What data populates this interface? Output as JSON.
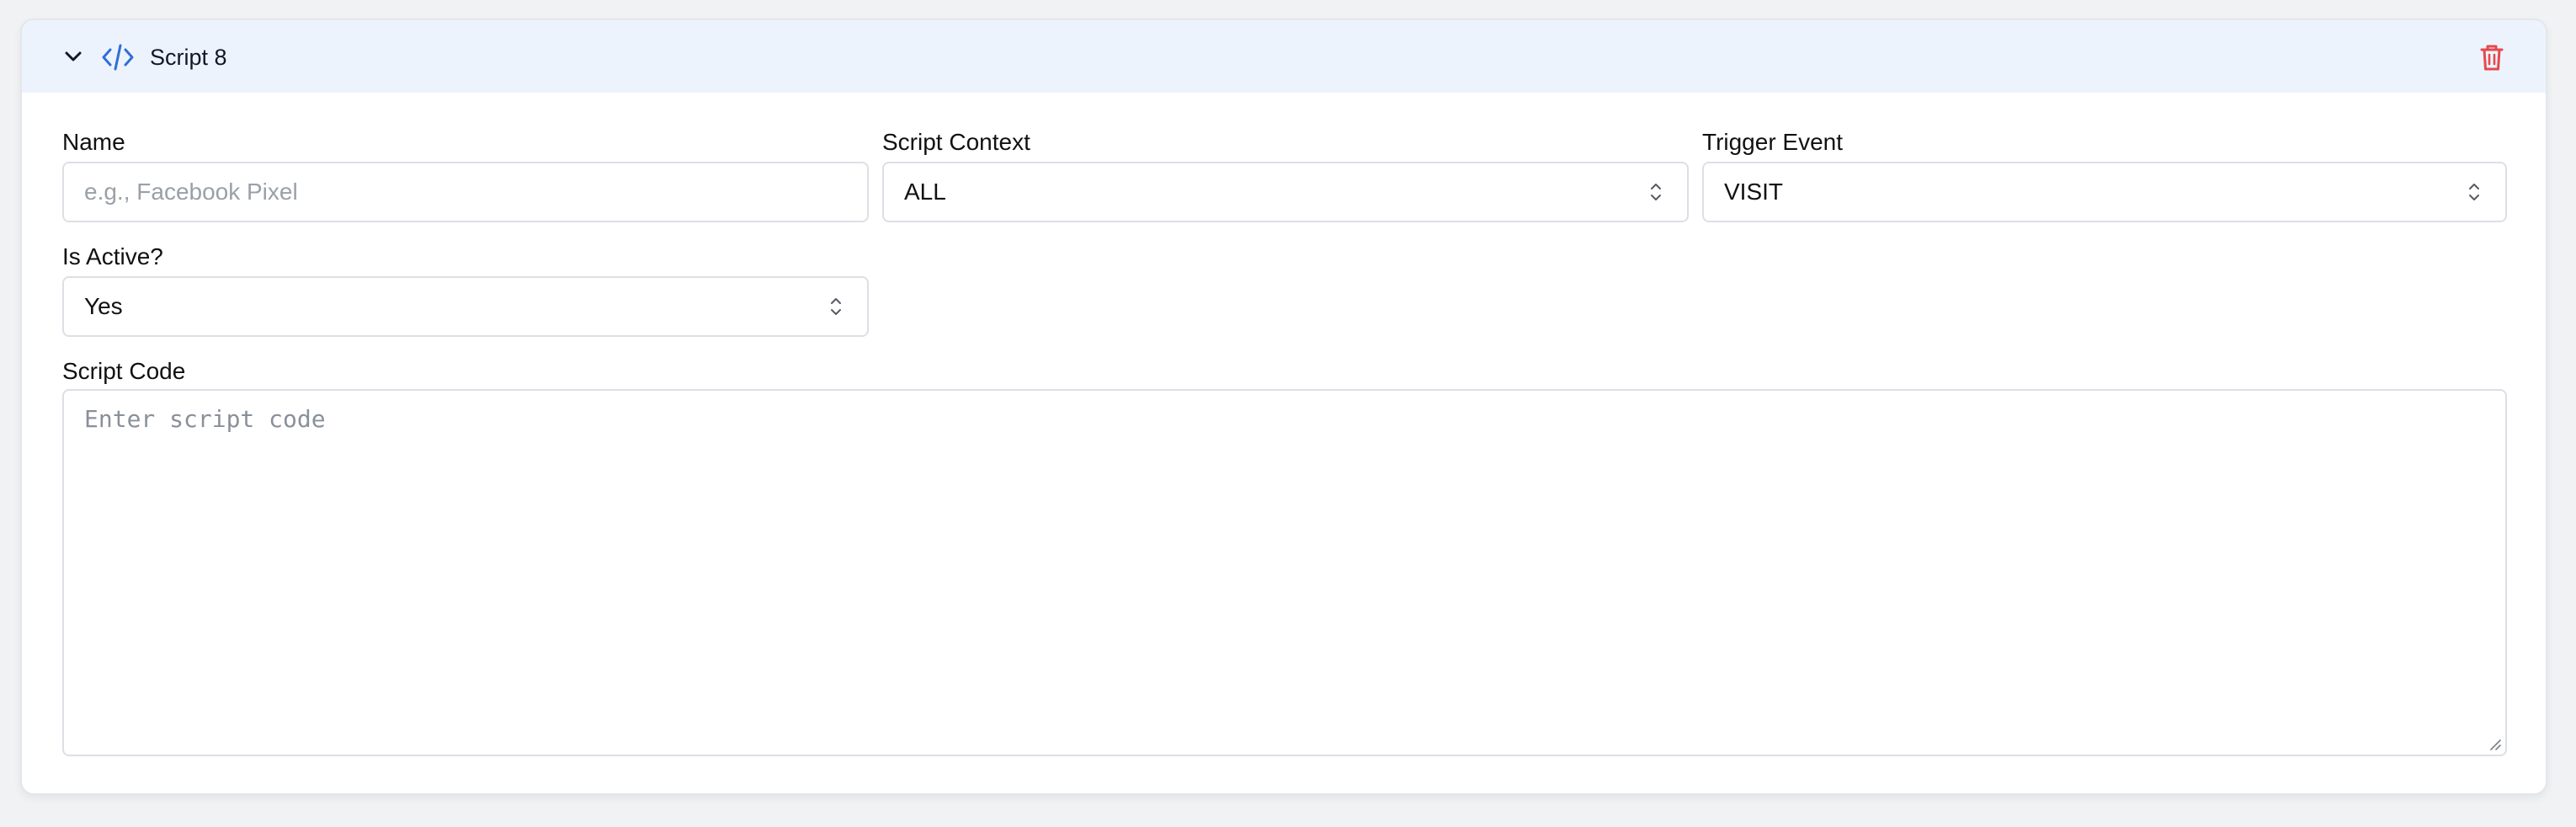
{
  "script_card": {
    "title": "Script 8",
    "icons": {
      "collapse": "chevron-down-icon",
      "type": "code-icon",
      "delete": "trash-icon"
    },
    "colors": {
      "header_bg": "#edf3fd",
      "accent": "#2f6fd6",
      "danger": "#e5484d"
    }
  },
  "form": {
    "name": {
      "label": "Name",
      "value": "",
      "placeholder": "e.g., Facebook Pixel"
    },
    "script_context": {
      "label": "Script Context",
      "selected": "ALL"
    },
    "trigger_event": {
      "label": "Trigger Event",
      "selected": "VISIT"
    },
    "is_active": {
      "label": "Is Active?",
      "selected": "Yes"
    },
    "script_code": {
      "label": "Script Code",
      "value": "",
      "placeholder": "Enter script code"
    }
  }
}
